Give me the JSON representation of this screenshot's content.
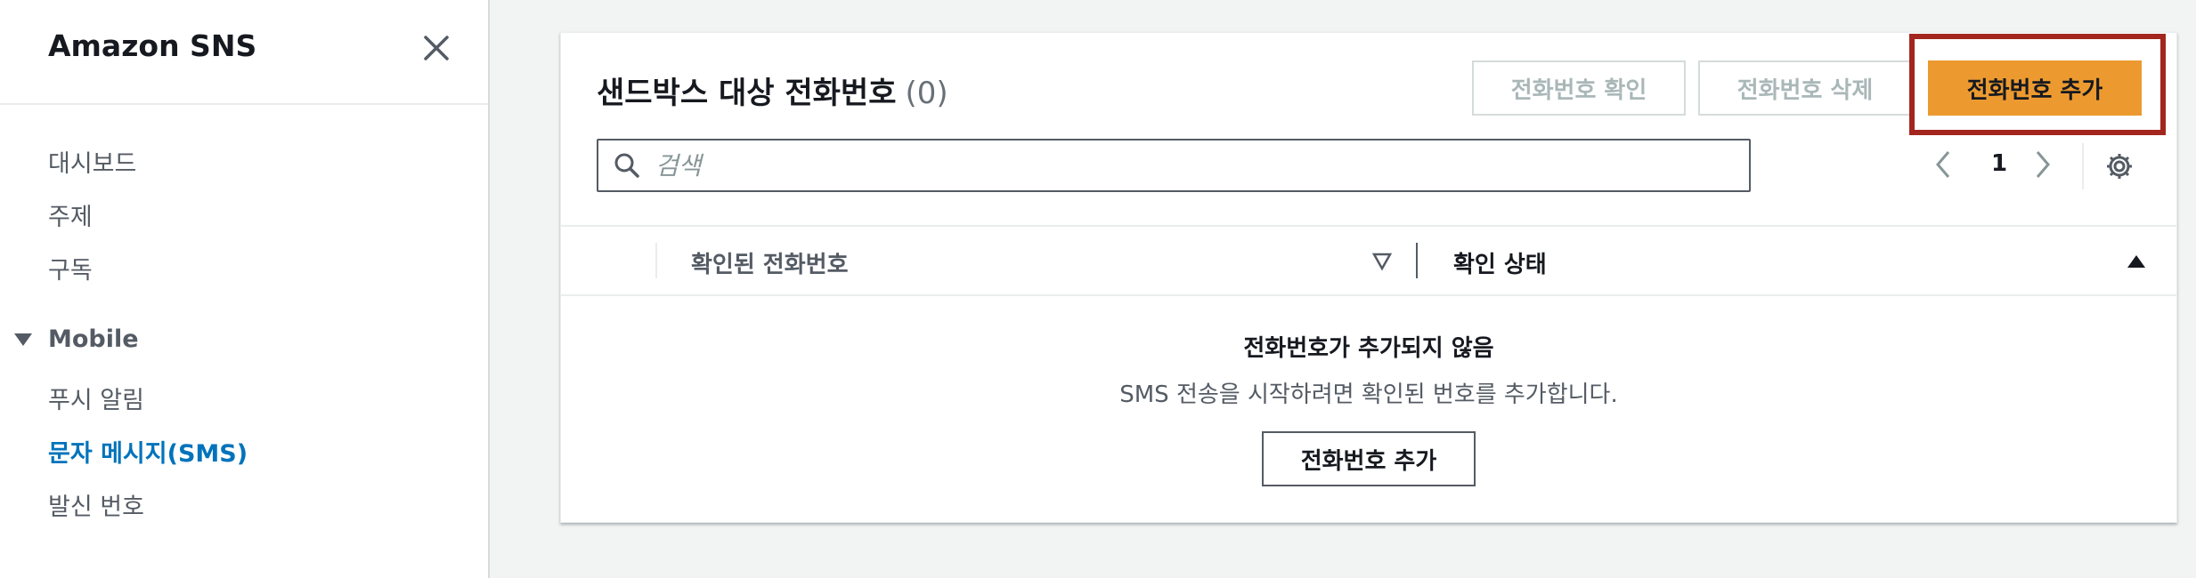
{
  "sidebar": {
    "title": "Amazon SNS",
    "items": [
      "대시보드",
      "주제",
      "구독"
    ],
    "section": "Mobile",
    "section_items": [
      "푸시 알림",
      "문자 메시지(SMS)",
      "발신 번호"
    ],
    "active_item": "문자 메시지(SMS)"
  },
  "panel": {
    "title": "샌드박스 대상 전화번호",
    "count": "(0)",
    "buttons": {
      "verify": "전화번호 확인",
      "delete": "전화번호 삭제",
      "add": "전화번호 추가"
    },
    "search": {
      "placeholder": "검색"
    },
    "pagination": {
      "page": "1"
    },
    "columns": [
      "확인된 전화번호",
      "확인 상태"
    ],
    "empty": {
      "title": "전화번호가 추가되지 않음",
      "description": "SMS 전송을 시작하려면 확인된 번호를 추가합니다.",
      "button": "전화번호 추가"
    }
  },
  "colors": {
    "primary_button": "#ec9a30",
    "active_link": "#0073bb",
    "highlight_border": "#a3261e"
  }
}
